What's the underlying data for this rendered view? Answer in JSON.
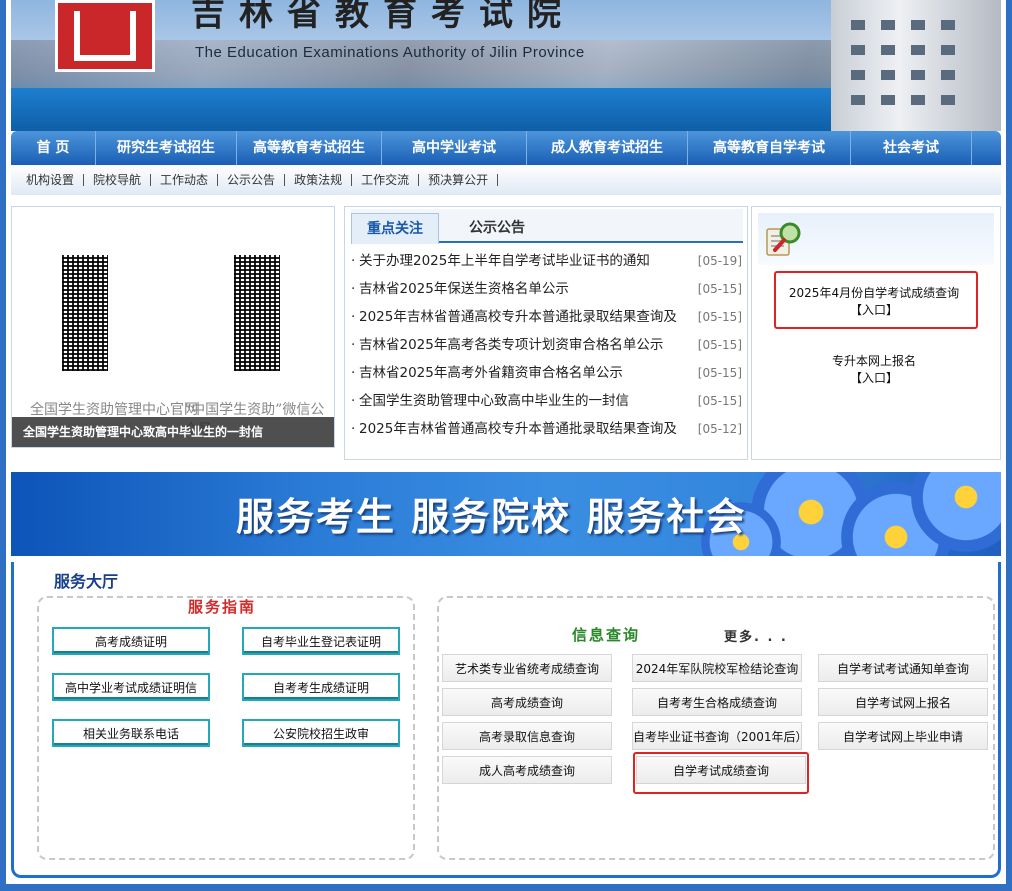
{
  "header": {
    "title": "吉林省教育考试院",
    "subtitle": "The Education Examinations Authority of Jilin Province"
  },
  "main_nav": [
    {
      "label": "首 页"
    },
    {
      "label": "研究生考试招生"
    },
    {
      "label": "高等教育考试招生"
    },
    {
      "label": "高中学业考试"
    },
    {
      "label": "成人教育考试招生"
    },
    {
      "label": "高等教育自学考试"
    },
    {
      "label": "社会考试"
    }
  ],
  "sub_nav": [
    {
      "label": "机构设置"
    },
    {
      "label": "院校导航"
    },
    {
      "label": "工作动态"
    },
    {
      "label": "公示公告"
    },
    {
      "label": "政策法规"
    },
    {
      "label": "工作交流"
    },
    {
      "label": "预决算公开"
    }
  ],
  "slideshow": {
    "qr_left_caption": "全国学生资助管理中心官网",
    "qr_right_caption": "“中国学生资助”微信公众号",
    "caption": "全国学生资助管理中心致高中毕业生的一封信"
  },
  "news": {
    "tabs": [
      {
        "label": "重点关注"
      },
      {
        "label": "公示公告"
      }
    ],
    "items": [
      {
        "title": "关于办理2025年上半年自学考试毕业证书的通知",
        "date": "[05-19]"
      },
      {
        "title": "吉林省2025年保送生资格名单公示",
        "date": "[05-15]"
      },
      {
        "title": "2025年吉林省普通高校专升本普通批录取结果查询及",
        "date": "[05-15]"
      },
      {
        "title": "吉林省2025年高考各类专项计划资审合格名单公示",
        "date": "[05-15]"
      },
      {
        "title": "吉林省2025年高考外省籍资审合格名单公示",
        "date": "[05-15]"
      },
      {
        "title": "全国学生资助管理中心致高中毕业生的一封信",
        "date": "[05-15]"
      },
      {
        "title": "2025年吉林省普通高校专升本普通批录取结果查询及",
        "date": "[05-12]"
      }
    ]
  },
  "quick": {
    "items": [
      {
        "line1": "2025年4月份自学考试成绩查询",
        "line2": "【入口】"
      },
      {
        "line1": "专升本网上报名",
        "line2": "【入口】"
      }
    ]
  },
  "slogan": "服务考生 服务院校 服务社会",
  "service_hall": {
    "title": "服务大厅",
    "guide": {
      "title": "服务指南",
      "buttons": [
        {
          "label": "高考成绩证明"
        },
        {
          "label": "自考毕业生登记表证明"
        },
        {
          "label": "高中学业考试成绩证明信"
        },
        {
          "label": "自考考生成绩证明"
        },
        {
          "label": "相关业务联系电话"
        },
        {
          "label": "公安院校招生政审"
        }
      ]
    },
    "query": {
      "title": "信息查询",
      "more": "更多. . .",
      "buttons": [
        {
          "label": "艺术类专业省统考成绩查询"
        },
        {
          "label": "2024年军队院校军检结论查询"
        },
        {
          "label": "自学考试考试通知单查询"
        },
        {
          "label": "高考成绩查询"
        },
        {
          "label": "自考考生合格成绩查询"
        },
        {
          "label": "自学考试网上报名"
        },
        {
          "label": "高考录取信息查询"
        },
        {
          "label": "自考毕业证书查询（2001年后）"
        },
        {
          "label": "自学考试网上毕业申请"
        },
        {
          "label": "成人高考成绩查询"
        },
        {
          "label": "自学考试成绩查询"
        }
      ]
    }
  },
  "colors": {
    "nav_blue": "#1a5fb4",
    "highlight_red": "#e02222",
    "guide_teal": "#23a8b8",
    "logo_red": "#c9272a"
  }
}
